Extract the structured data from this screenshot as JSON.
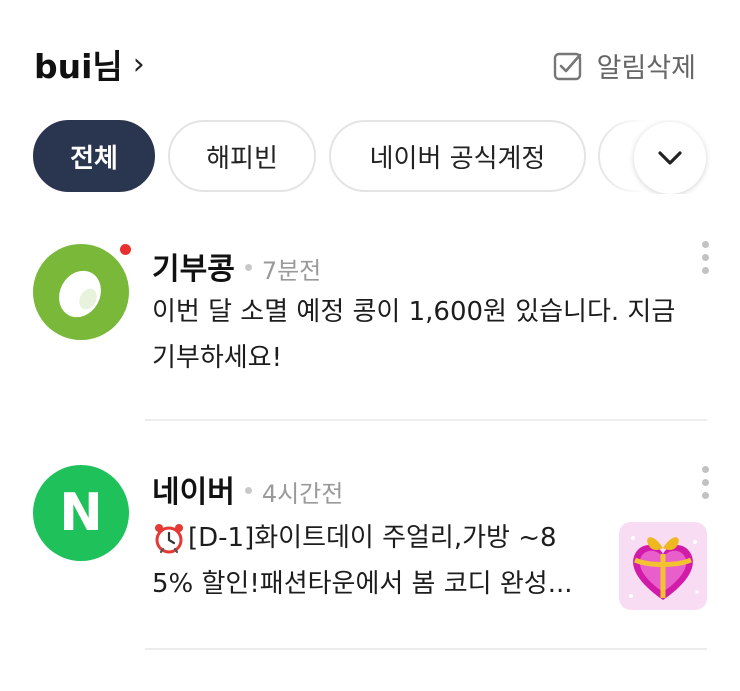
{
  "header": {
    "user_name": "bui님",
    "chevron": "›",
    "delete_all_label": "알림삭제"
  },
  "filters": {
    "chips": [
      {
        "label": "전체",
        "active": true
      },
      {
        "label": "해피빈",
        "active": false
      },
      {
        "label": "네이버 공식계정",
        "active": false
      }
    ],
    "expand_icon": "chevron-down-icon"
  },
  "notifications": [
    {
      "sender": "기부콩",
      "time": "7분전",
      "unread": true,
      "message_line1": "이번 달 소멸 예정 콩이 1,600원 있습니다. 지금",
      "message_line2": "기부하세요!",
      "avatar_color": "#7ab83a"
    },
    {
      "sender": "네이버",
      "time": "4시간전",
      "unread": false,
      "message_line1": "[D-1]화이트데이 주얼리,가방 ~8",
      "message_line2": "5% 할인!패션타운에서 봄 코디 완성...",
      "avatar_letter": "N",
      "avatar_color": "#1fc15a",
      "thumbnail": "gift-heart-box"
    }
  ],
  "colors": {
    "active_chip": "#2a3550",
    "unread_dot": "#e8302f",
    "time_text": "#9a9a9a"
  }
}
